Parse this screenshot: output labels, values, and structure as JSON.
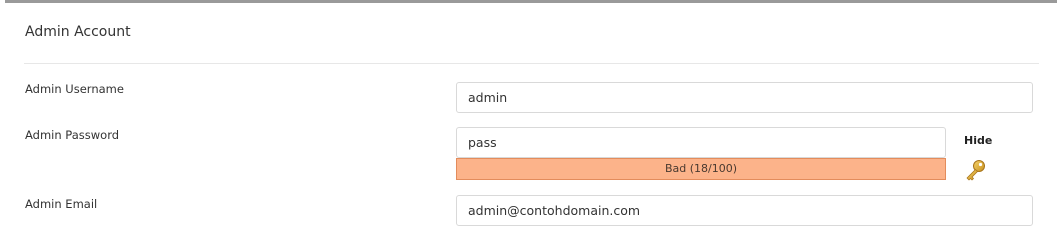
{
  "section": {
    "title": "Admin Account"
  },
  "fields": {
    "username": {
      "label": "Admin Username",
      "value": "admin"
    },
    "password": {
      "label": "Admin Password",
      "value": "pass",
      "toggle_label": "Hide",
      "strength": {
        "text": "Bad (18/100)",
        "score": 18,
        "max": 100,
        "fill_color": "#fcb38a"
      },
      "generator_icon": "key-icon"
    },
    "email": {
      "label": "Admin Email",
      "value": "admin@contohdomain.com"
    }
  }
}
